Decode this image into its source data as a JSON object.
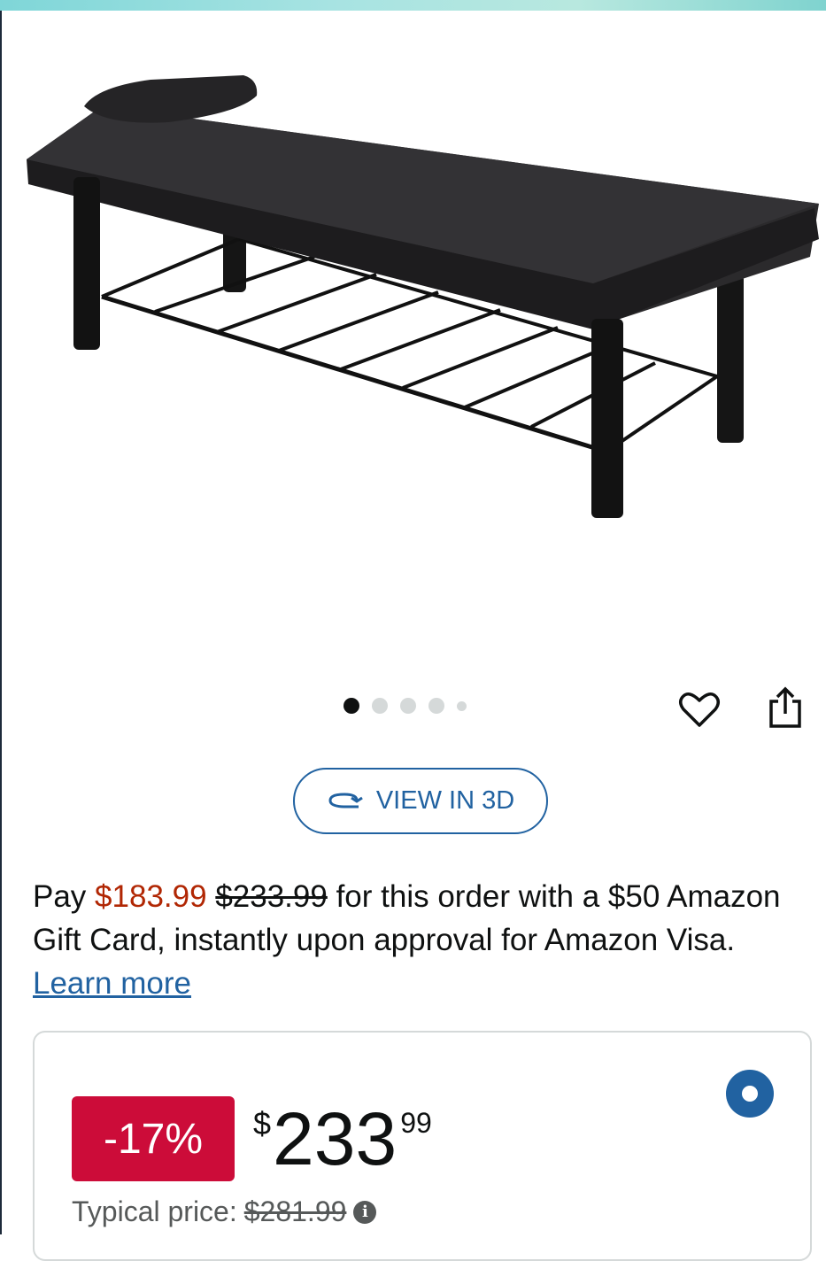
{
  "gallery": {
    "image_alt": "Black massage table with storage shelf",
    "dot_count": 5,
    "active_index": 0
  },
  "actions": {
    "favorite_icon": "heart-icon",
    "share_icon": "share-icon"
  },
  "view3d": {
    "label": "VIEW IN 3D",
    "icon": "rotate-3d-icon"
  },
  "offer": {
    "pay": "Pay",
    "promo_price": "$183.99",
    "orig_price": "$233.99",
    "middle": "for this order with a $50 Amazon Gift Card, instantly upon approval for Amazon Visa.",
    "learn_more": "Learn more"
  },
  "pricing": {
    "discount": "-17%",
    "currency": "$",
    "price_whole": "233",
    "price_fraction": "99",
    "typical_label": "Typical price:",
    "typical_value": "$281.99",
    "info_icon": "info-icon"
  },
  "colors": {
    "accent": "#2162a1",
    "deal_red": "#cc0c39",
    "price_red": "#b12704"
  }
}
